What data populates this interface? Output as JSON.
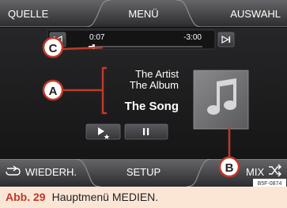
{
  "header": {
    "left_tab": "QUELLE",
    "center_tab": "MENÜ",
    "right_tab": "AUSWAHL"
  },
  "player": {
    "elapsed": "0:07",
    "remaining": "-3:00",
    "progress": 0.04,
    "artist": "The Artist",
    "album": "The Album",
    "song": "The Song",
    "album_art_icon": "music-note-icon",
    "prev_icon": "skip-previous-icon",
    "next_icon": "skip-next-icon",
    "play_favorite_icon": "play-star-icon",
    "pause_icon": "pause-icon"
  },
  "footer": {
    "repeat_label": "WIEDERH.",
    "repeat_icon": "repeat-icon",
    "setup_label": "SETUP",
    "mix_label": "MIX",
    "mix_icon": "shuffle-icon"
  },
  "callouts": {
    "a": "A",
    "b": "B",
    "c": "C"
  },
  "doc_code": "B5F-0874",
  "caption": {
    "number": "Abb. 29",
    "text": "Hauptmenü MEDIEN."
  },
  "colors": {
    "screen_bg": "#1b1b1d",
    "bar_top": "#4a4a4d",
    "text_light": "#ffffff",
    "accent_red": "#c0392b",
    "caption_bg": "#fbe6d6"
  }
}
